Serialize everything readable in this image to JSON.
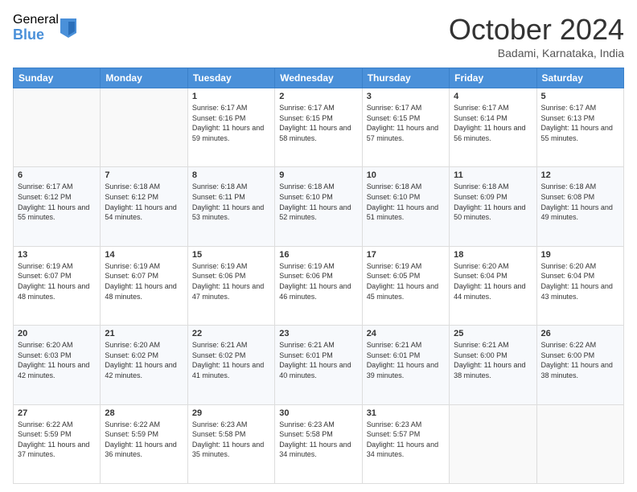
{
  "header": {
    "logo_general": "General",
    "logo_blue": "Blue",
    "month_title": "October 2024",
    "subtitle": "Badami, Karnataka, India"
  },
  "weekdays": [
    "Sunday",
    "Monday",
    "Tuesday",
    "Wednesday",
    "Thursday",
    "Friday",
    "Saturday"
  ],
  "weeks": [
    [
      {
        "num": "",
        "info": ""
      },
      {
        "num": "",
        "info": ""
      },
      {
        "num": "1",
        "info": "Sunrise: 6:17 AM\nSunset: 6:16 PM\nDaylight: 11 hours and 59 minutes."
      },
      {
        "num": "2",
        "info": "Sunrise: 6:17 AM\nSunset: 6:15 PM\nDaylight: 11 hours and 58 minutes."
      },
      {
        "num": "3",
        "info": "Sunrise: 6:17 AM\nSunset: 6:15 PM\nDaylight: 11 hours and 57 minutes."
      },
      {
        "num": "4",
        "info": "Sunrise: 6:17 AM\nSunset: 6:14 PM\nDaylight: 11 hours and 56 minutes."
      },
      {
        "num": "5",
        "info": "Sunrise: 6:17 AM\nSunset: 6:13 PM\nDaylight: 11 hours and 55 minutes."
      }
    ],
    [
      {
        "num": "6",
        "info": "Sunrise: 6:17 AM\nSunset: 6:12 PM\nDaylight: 11 hours and 55 minutes."
      },
      {
        "num": "7",
        "info": "Sunrise: 6:18 AM\nSunset: 6:12 PM\nDaylight: 11 hours and 54 minutes."
      },
      {
        "num": "8",
        "info": "Sunrise: 6:18 AM\nSunset: 6:11 PM\nDaylight: 11 hours and 53 minutes."
      },
      {
        "num": "9",
        "info": "Sunrise: 6:18 AM\nSunset: 6:10 PM\nDaylight: 11 hours and 52 minutes."
      },
      {
        "num": "10",
        "info": "Sunrise: 6:18 AM\nSunset: 6:10 PM\nDaylight: 11 hours and 51 minutes."
      },
      {
        "num": "11",
        "info": "Sunrise: 6:18 AM\nSunset: 6:09 PM\nDaylight: 11 hours and 50 minutes."
      },
      {
        "num": "12",
        "info": "Sunrise: 6:18 AM\nSunset: 6:08 PM\nDaylight: 11 hours and 49 minutes."
      }
    ],
    [
      {
        "num": "13",
        "info": "Sunrise: 6:19 AM\nSunset: 6:07 PM\nDaylight: 11 hours and 48 minutes."
      },
      {
        "num": "14",
        "info": "Sunrise: 6:19 AM\nSunset: 6:07 PM\nDaylight: 11 hours and 48 minutes."
      },
      {
        "num": "15",
        "info": "Sunrise: 6:19 AM\nSunset: 6:06 PM\nDaylight: 11 hours and 47 minutes."
      },
      {
        "num": "16",
        "info": "Sunrise: 6:19 AM\nSunset: 6:06 PM\nDaylight: 11 hours and 46 minutes."
      },
      {
        "num": "17",
        "info": "Sunrise: 6:19 AM\nSunset: 6:05 PM\nDaylight: 11 hours and 45 minutes."
      },
      {
        "num": "18",
        "info": "Sunrise: 6:20 AM\nSunset: 6:04 PM\nDaylight: 11 hours and 44 minutes."
      },
      {
        "num": "19",
        "info": "Sunrise: 6:20 AM\nSunset: 6:04 PM\nDaylight: 11 hours and 43 minutes."
      }
    ],
    [
      {
        "num": "20",
        "info": "Sunrise: 6:20 AM\nSunset: 6:03 PM\nDaylight: 11 hours and 42 minutes."
      },
      {
        "num": "21",
        "info": "Sunrise: 6:20 AM\nSunset: 6:02 PM\nDaylight: 11 hours and 42 minutes."
      },
      {
        "num": "22",
        "info": "Sunrise: 6:21 AM\nSunset: 6:02 PM\nDaylight: 11 hours and 41 minutes."
      },
      {
        "num": "23",
        "info": "Sunrise: 6:21 AM\nSunset: 6:01 PM\nDaylight: 11 hours and 40 minutes."
      },
      {
        "num": "24",
        "info": "Sunrise: 6:21 AM\nSunset: 6:01 PM\nDaylight: 11 hours and 39 minutes."
      },
      {
        "num": "25",
        "info": "Sunrise: 6:21 AM\nSunset: 6:00 PM\nDaylight: 11 hours and 38 minutes."
      },
      {
        "num": "26",
        "info": "Sunrise: 6:22 AM\nSunset: 6:00 PM\nDaylight: 11 hours and 38 minutes."
      }
    ],
    [
      {
        "num": "27",
        "info": "Sunrise: 6:22 AM\nSunset: 5:59 PM\nDaylight: 11 hours and 37 minutes."
      },
      {
        "num": "28",
        "info": "Sunrise: 6:22 AM\nSunset: 5:59 PM\nDaylight: 11 hours and 36 minutes."
      },
      {
        "num": "29",
        "info": "Sunrise: 6:23 AM\nSunset: 5:58 PM\nDaylight: 11 hours and 35 minutes."
      },
      {
        "num": "30",
        "info": "Sunrise: 6:23 AM\nSunset: 5:58 PM\nDaylight: 11 hours and 34 minutes."
      },
      {
        "num": "31",
        "info": "Sunrise: 6:23 AM\nSunset: 5:57 PM\nDaylight: 11 hours and 34 minutes."
      },
      {
        "num": "",
        "info": ""
      },
      {
        "num": "",
        "info": ""
      }
    ]
  ]
}
